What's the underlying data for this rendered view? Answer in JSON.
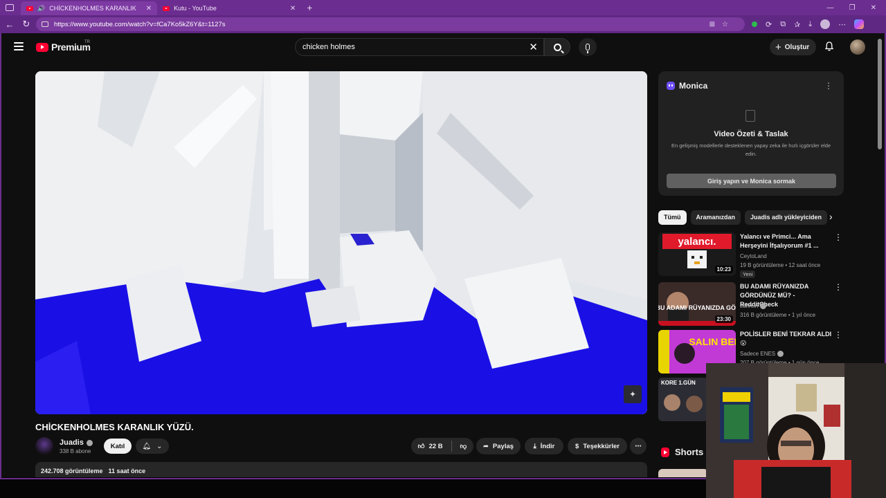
{
  "browser": {
    "tabs": [
      {
        "title": "CHİCKENHOLMES KARANLIK",
        "active": true,
        "audio": true
      },
      {
        "title": "Kutu - YouTube",
        "active": false,
        "audio": false
      }
    ],
    "new_tab": "+",
    "url": "https://www.youtube.com/watch?v=fCa7Ko5kZ6Y&t=1127s"
  },
  "youtube": {
    "logo_text": "Premium",
    "country_code": "TR",
    "search_value": "chicken holmes",
    "create_label": "Oluştur"
  },
  "video": {
    "title": "CHİCKENHOLMES KARANLIK YÜZÜ.",
    "channel": "Juadis",
    "subscribers": "338 B abone",
    "join_label": "Katıl",
    "likes": "22 B",
    "share_label": "Paylaş",
    "download_label": "İndir",
    "thanks_label": "Teşekkürler",
    "views": "242.708 görüntüleme",
    "uploaded": "11 saat önce"
  },
  "monica": {
    "name": "Monica",
    "title": "Video Özeti & Taslak",
    "subtitle": "En gelişmiş modellerle desteklenen yapay zeka ile hızlı içgörüler elde edin.",
    "button": "Giriş yapın ve Monica sormak"
  },
  "chips": [
    "Tümü",
    "Aramanızdan",
    "Juadis adlı yükleyiciden"
  ],
  "recommendations": [
    {
      "title": "Yalancı ve Primci... Ama Herşeyini İfşalıyorum #1 ...",
      "channel": "CeytoLand",
      "meta": "19 B görüntüleme • 12 saat önce",
      "badge": "Yeni",
      "duration": "10:23",
      "thumb_text": "yalancı."
    },
    {
      "title": "BU ADAMI RÜYANIZDA GÖRDÜNÜZ MÜ? - RedditCheck",
      "channel": "Jahrein",
      "meta": "316 B görüntüleme • 1 yıl önce",
      "duration": "23:30",
      "thumb_text": "BU ADAMI RÜYANIZDA GÖRDÜNÜZ?"
    },
    {
      "title": "POLİSLER BENİ TEKRAR ALDI 😮",
      "channel": "Sadece ENES",
      "meta": "207 B görüntüleme • 1 gün önce",
      "thumb_text": "SALIN BENİ"
    },
    {
      "title": "",
      "channel": "",
      "meta": "",
      "thumb_text": "KORE 1.GÜN"
    }
  ],
  "shorts_label": "Shorts",
  "colors": {
    "browser_purple": "#6b2d8f",
    "yt_red": "#ff0033",
    "page_bg": "#0f0f0f",
    "video_blue": "#1a10e6"
  }
}
